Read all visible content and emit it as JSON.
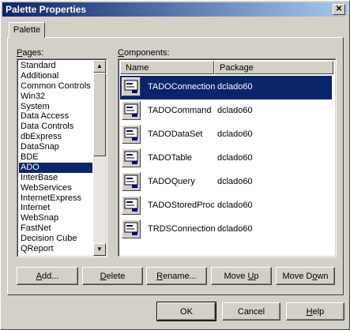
{
  "window": {
    "title": "Palette Properties",
    "close_glyph": "✕"
  },
  "tab": {
    "label": "Palette"
  },
  "pages": {
    "label_prefix": "",
    "label_underlined": "P",
    "label_rest": "ages:",
    "items": [
      "Standard",
      "Additional",
      "Common Controls",
      "Win32",
      "System",
      "Data Access",
      "Data Controls",
      "dbExpress",
      "DataSnap",
      "BDE",
      "ADO",
      "InterBase",
      "WebServices",
      "InternetExpress",
      "Internet",
      "WebSnap",
      "FastNet",
      "Decision Cube",
      "QReport"
    ],
    "selected_index": 10
  },
  "components": {
    "label_prefix": "",
    "label_underlined": "C",
    "label_rest": "omponents:",
    "columns": [
      "Name",
      "Package"
    ],
    "rows": [
      {
        "name": "TADOConnection",
        "package": "dclado60",
        "icon": "ado-connection-icon"
      },
      {
        "name": "TADOCommand",
        "package": "dclado60",
        "icon": "ado-command-icon"
      },
      {
        "name": "TADODataSet",
        "package": "dclado60",
        "icon": "ado-dataset-icon"
      },
      {
        "name": "TADOTable",
        "package": "dclado60",
        "icon": "ado-table-icon"
      },
      {
        "name": "TADOQuery",
        "package": "dclado60",
        "icon": "ado-query-icon"
      },
      {
        "name": "TADOStoredProc",
        "package": "dclado60",
        "icon": "ado-storedproc-icon"
      },
      {
        "name": "TRDSConnection",
        "package": "dclado60",
        "icon": "rds-connection-icon"
      }
    ],
    "selected_index": 0
  },
  "buttons": {
    "add": {
      "u": "A",
      "rest": "dd..."
    },
    "delete": {
      "u": "D",
      "rest": "elete"
    },
    "rename": {
      "u": "R",
      "rest": "ename..."
    },
    "move_up": {
      "pre": "Move ",
      "u": "U",
      "rest": "p"
    },
    "move_down": {
      "pre": "Move D",
      "u": "o",
      "rest": "wn"
    },
    "ok": "OK",
    "cancel": "Cancel",
    "help": {
      "u": "H",
      "rest": "elp"
    }
  },
  "colors": {
    "selection": "#0a246a",
    "face": "#d4d0c8"
  }
}
